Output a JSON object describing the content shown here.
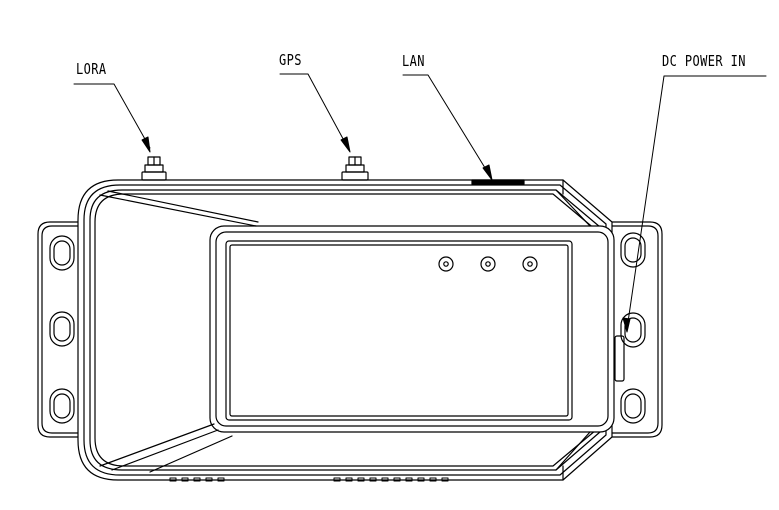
{
  "labels": {
    "lora": "LORA",
    "gps": "GPS",
    "lan": "LAN",
    "dc_power": "DC POWER IN"
  },
  "colors": {
    "line": "#000000",
    "background": "#ffffff"
  }
}
